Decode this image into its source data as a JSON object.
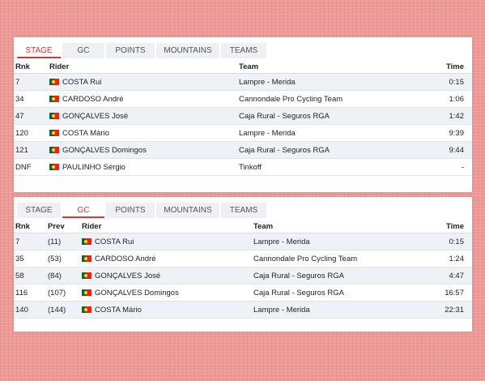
{
  "tabs": [
    "STAGE",
    "GC",
    "POINTS",
    "MOUNTAINS",
    "TEAMS"
  ],
  "flag_colors": {
    "green": "#046a38",
    "red": "#da291c",
    "shield": "#ffe000"
  },
  "accent_color": "#e0323c",
  "stage": {
    "active_tab": "STAGE",
    "headers": {
      "rank": "Rnk",
      "rider": "Rider",
      "team": "Team",
      "time": "Time"
    },
    "rows": [
      {
        "rank": "7",
        "rider": "COSTA Rui",
        "team": "Lampre - Merida",
        "time": "0:15"
      },
      {
        "rank": "34",
        "rider": "CARDOSO André",
        "team": "Cannondale Pro Cycling Team",
        "time": "1:06"
      },
      {
        "rank": "47",
        "rider": "GONÇALVES José",
        "team": "Caja Rural - Seguros RGA",
        "time": "1:42"
      },
      {
        "rank": "120",
        "rider": "COSTA Mário",
        "team": "Lampre - Merida",
        "time": "9:39"
      },
      {
        "rank": "121",
        "rider": "GONÇALVES Domingos",
        "team": "Caja Rural - Seguros RGA",
        "time": "9:44"
      },
      {
        "rank": "DNF",
        "rider": "PAULINHO Sérgio",
        "team": "Tinkoff",
        "time": "-"
      }
    ]
  },
  "gc": {
    "active_tab": "GC",
    "headers": {
      "rank": "Rnk",
      "prev": "Prev",
      "rider": "Rider",
      "team": "Team",
      "time": "Time"
    },
    "rows": [
      {
        "rank": "7",
        "prev": "(11)",
        "rider": "COSTA Rui",
        "team": "Lampre - Merida",
        "time": "0:15"
      },
      {
        "rank": "35",
        "prev": "(53)",
        "rider": "CARDOSO André",
        "team": "Cannondale Pro Cycling Team",
        "time": "1:24"
      },
      {
        "rank": "58",
        "prev": "(84)",
        "rider": "GONÇALVES José",
        "team": "Caja Rural - Seguros RGA",
        "time": "4:47"
      },
      {
        "rank": "116",
        "prev": "(107)",
        "rider": "GONÇALVES Domingos",
        "team": "Caja Rural - Seguros RGA",
        "time": "16:57"
      },
      {
        "rank": "140",
        "prev": "(144)",
        "rider": "COSTA Mário",
        "team": "Lampre - Merida",
        "time": "22:31"
      }
    ]
  }
}
